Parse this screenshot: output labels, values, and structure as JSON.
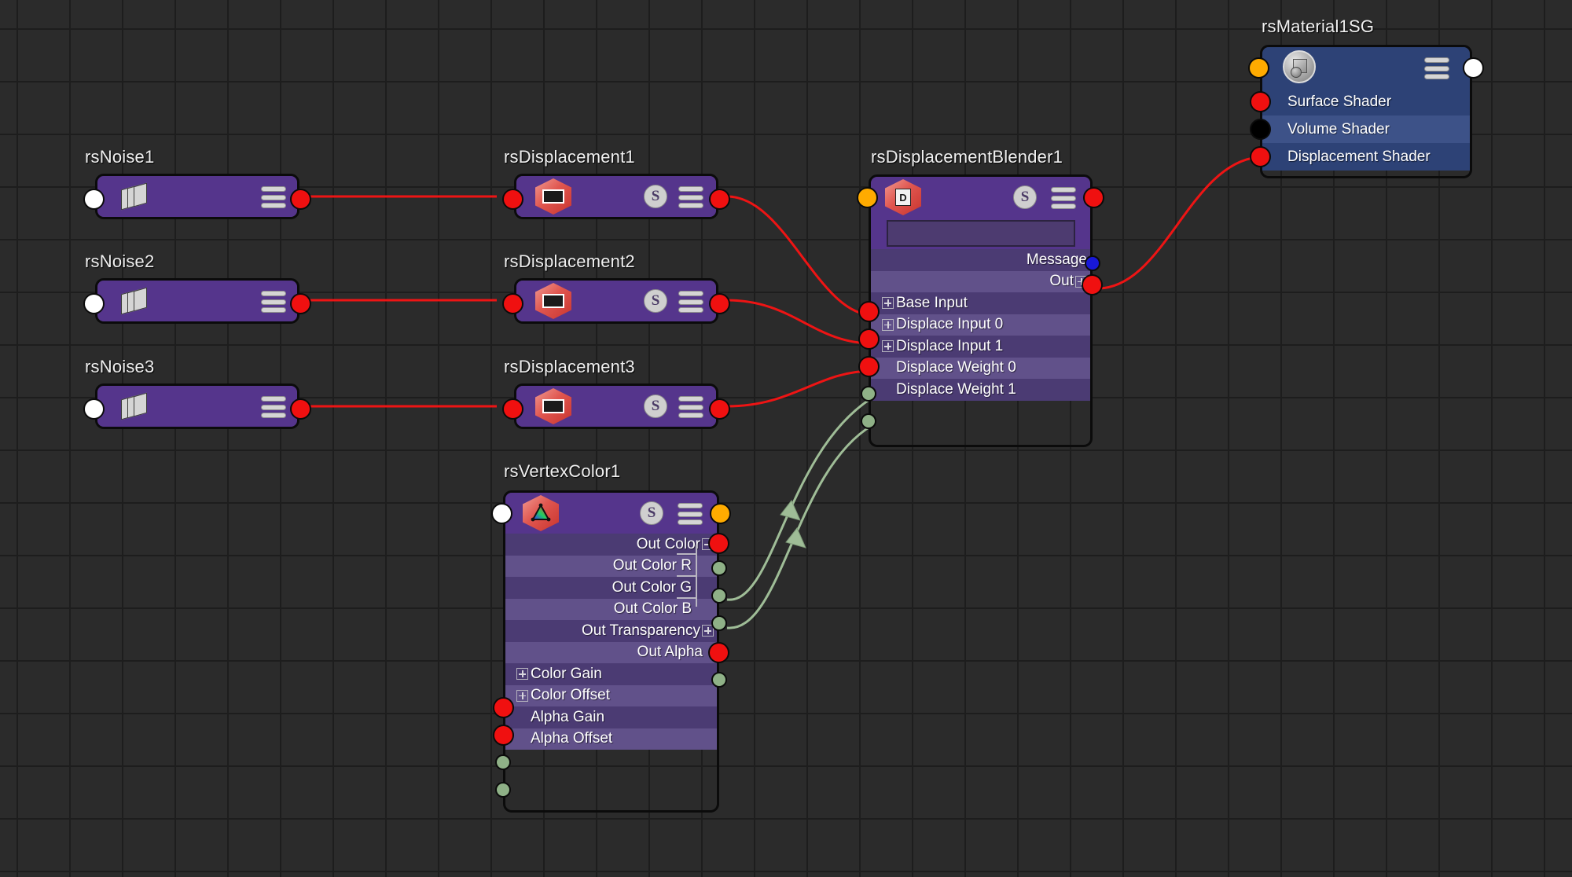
{
  "app": {
    "editor": "node-graph",
    "background_color": "#2b2b2b",
    "grid_color": "#1d1d1d"
  },
  "palette": {
    "node_purple_header": "#55358c",
    "node_purple_row_dark": "#4b3b73",
    "node_purple_row_light": "#61518a",
    "node_blue_header": "#2d4276",
    "node_blue_row_light": "#3d5288",
    "wire_red": "#ee1414",
    "wire_green": "#9fbd97",
    "plug_red": "#f01010",
    "plug_orange": "#ffab00",
    "plug_blue": "#1818d8",
    "plug_green": "#8fb187",
    "plug_white": "#ffffff",
    "plug_black": "#000000"
  },
  "nodes": [
    {
      "id": "rsNoise1",
      "title": "rsNoise1",
      "icon": "noise-stack-icon",
      "badges": [
        "hamburger-menu-icon"
      ],
      "rows": []
    },
    {
      "id": "rsNoise2",
      "title": "rsNoise2",
      "icon": "noise-stack-icon",
      "badges": [
        "hamburger-menu-icon"
      ],
      "rows": []
    },
    {
      "id": "rsNoise3",
      "title": "rsNoise3",
      "icon": "noise-stack-icon",
      "badges": [
        "hamburger-menu-icon"
      ],
      "rows": []
    },
    {
      "id": "rsDisplacement1",
      "title": "rsDisplacement1",
      "icon": "displacement-hex-icon",
      "badges": [
        "s-badge",
        "hamburger-menu-icon"
      ],
      "rows": []
    },
    {
      "id": "rsDisplacement2",
      "title": "rsDisplacement2",
      "icon": "displacement-hex-icon",
      "badges": [
        "s-badge",
        "hamburger-menu-icon"
      ],
      "rows": []
    },
    {
      "id": "rsDisplacement3",
      "title": "rsDisplacement3",
      "icon": "displacement-hex-icon",
      "badges": [
        "s-badge",
        "hamburger-menu-icon"
      ],
      "rows": []
    },
    {
      "id": "rsDisplacementBlender1",
      "title": "rsDisplacementBlender1",
      "icon": "blender-hex-icon",
      "badges": [
        "s-badge",
        "hamburger-menu-icon"
      ],
      "value_field": "",
      "rows": [
        {
          "label": "Message",
          "side": "out",
          "plug": "blue",
          "expander": "none"
        },
        {
          "label": "Out",
          "side": "out",
          "plug": "red",
          "expander": "plus"
        },
        {
          "label": "Base Input",
          "side": "in",
          "plug": "red",
          "expander": "plus"
        },
        {
          "label": "Displace Input 0",
          "side": "in",
          "plug": "red",
          "expander": "plus"
        },
        {
          "label": "Displace Input 1",
          "side": "in",
          "plug": "red",
          "expander": "plus"
        },
        {
          "label": "Displace Weight 0",
          "side": "in",
          "plug": "green",
          "expander": "none"
        },
        {
          "label": "Displace Weight 1",
          "side": "in",
          "plug": "green",
          "expander": "none"
        }
      ]
    },
    {
      "id": "rsVertexColor1",
      "title": "rsVertexColor1",
      "icon": "vertexcolor-hex-icon",
      "badges": [
        "s-badge",
        "hamburger-menu-icon"
      ],
      "rows": [
        {
          "label": "Out Color",
          "side": "out",
          "plug": "red",
          "expander": "minus"
        },
        {
          "label": "Out Color R",
          "side": "out",
          "plug": "green",
          "expander": "none"
        },
        {
          "label": "Out Color G",
          "side": "out",
          "plug": "green",
          "expander": "none"
        },
        {
          "label": "Out Color B",
          "side": "out",
          "plug": "green",
          "expander": "none"
        },
        {
          "label": "Out Transparency",
          "side": "out",
          "plug": "red",
          "expander": "plus"
        },
        {
          "label": "Out Alpha",
          "side": "out",
          "plug": "green",
          "expander": "none"
        },
        {
          "label": "Color Gain",
          "side": "in",
          "plug": "red",
          "expander": "plus"
        },
        {
          "label": "Color Offset",
          "side": "in",
          "plug": "red",
          "expander": "plus"
        },
        {
          "label": "Alpha Gain",
          "side": "in",
          "plug": "green",
          "expander": "none"
        },
        {
          "label": "Alpha Offset",
          "side": "in",
          "plug": "green",
          "expander": "none"
        }
      ]
    },
    {
      "id": "rsMaterial1SG",
      "title": "rsMaterial1SG",
      "icon": "shading-group-icon",
      "badges": [
        "hamburger-menu-icon"
      ],
      "rows": [
        {
          "label": "Surface Shader",
          "side": "in",
          "plug": "red",
          "expander": "none"
        },
        {
          "label": "Volume Shader",
          "side": "in",
          "plug": "black",
          "expander": "none"
        },
        {
          "label": "Displacement Shader",
          "side": "in",
          "plug": "red",
          "expander": "none"
        }
      ]
    }
  ],
  "connections": [
    {
      "from": "rsNoise1.out",
      "to": "rsDisplacement1.in",
      "color": "red"
    },
    {
      "from": "rsNoise2.out",
      "to": "rsDisplacement2.in",
      "color": "red"
    },
    {
      "from": "rsNoise3.out",
      "to": "rsDisplacement3.in",
      "color": "red"
    },
    {
      "from": "rsDisplacement1.out",
      "to": "rsDisplacementBlender1.Base Input",
      "color": "red"
    },
    {
      "from": "rsDisplacement2.out",
      "to": "rsDisplacementBlender1.Displace Input 0",
      "color": "red"
    },
    {
      "from": "rsDisplacement3.out",
      "to": "rsDisplacementBlender1.Displace Input 1",
      "color": "red"
    },
    {
      "from": "rsVertexColor1.Out Color G",
      "to": "rsDisplacementBlender1.Displace Weight 0",
      "color": "green"
    },
    {
      "from": "rsVertexColor1.Out Color B",
      "to": "rsDisplacementBlender1.Displace Weight 1",
      "color": "green"
    },
    {
      "from": "rsDisplacementBlender1.Out",
      "to": "rsMaterial1SG.Displacement Shader",
      "color": "red"
    }
  ],
  "labels": {
    "s_badge": "S",
    "blender_glyph": "D"
  }
}
